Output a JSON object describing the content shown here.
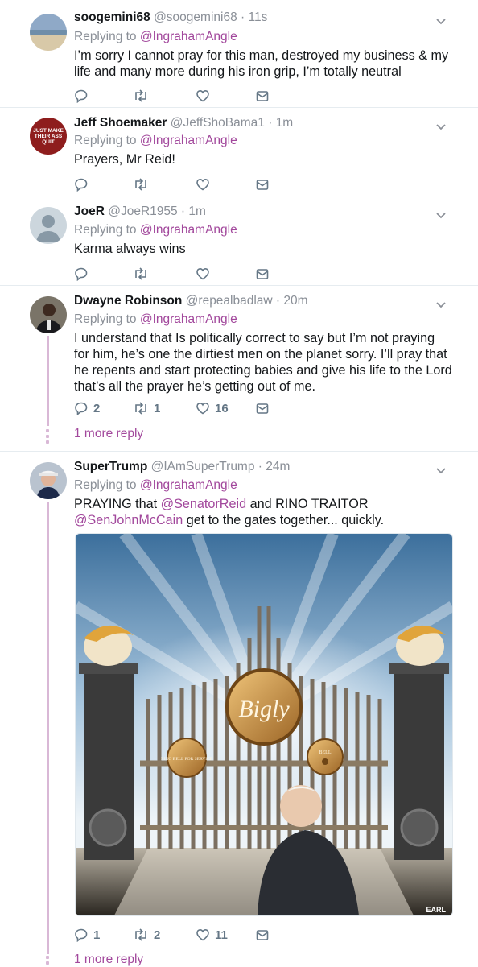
{
  "tweets": [
    {
      "name": "soogemini68",
      "handle": "@soogemini68",
      "sep": " · ",
      "time": "11s",
      "replying_prefix": "Replying to ",
      "replying_to": "@IngrahamAngle",
      "text": "I’m sorry I cannot pray for this man, destroyed my business & my life and many more during his iron grip, I’m totally neutral",
      "counts": {
        "reply": "",
        "retweet": "",
        "like": ""
      }
    },
    {
      "name": "Jeff Shoemaker",
      "handle": "@JeffShoBama1",
      "sep": " · ",
      "time": "1m",
      "replying_prefix": "Replying to ",
      "replying_to": "@IngrahamAngle",
      "text": "Prayers, Mr Reid!",
      "avatar_text": "JUST MAKE THEIR ASS QUIT",
      "counts": {
        "reply": "",
        "retweet": "",
        "like": ""
      }
    },
    {
      "name": "JoeR",
      "handle": "@JoeR1955",
      "sep": " · ",
      "time": "1m",
      "replying_prefix": "Replying to ",
      "replying_to": "@IngrahamAngle",
      "text": "Karma always wins",
      "counts": {
        "reply": "",
        "retweet": "",
        "like": ""
      }
    },
    {
      "name": "Dwayne Robinson",
      "handle": "@repealbadlaw",
      "sep": " · ",
      "time": "20m",
      "replying_prefix": "Replying to ",
      "replying_to": "@IngrahamAngle",
      "text": "I understand that Is politically correct to say but I’m not praying for him, he’s one the dirtiest men on the planet sorry. I’ll pray that he repents and start protecting babies and give his life to the Lord that’s all the prayer he’s getting out of me.",
      "counts": {
        "reply": "2",
        "retweet": "1",
        "like": "16"
      },
      "more_reply": "1 more reply"
    },
    {
      "name": "SuperTrump",
      "handle": "@IAmSuperTrump",
      "sep": " · ",
      "time": "24m",
      "replying_prefix": "Replying to ",
      "replying_to": "@IngrahamAngle",
      "text_parts": [
        "PRAYING that ",
        "@SenatorReid",
        " and RINO TRAITOR ",
        "@SenJohnMcCain",
        " get to the gates together... quickly."
      ],
      "image": {
        "sign_main": "Bigly",
        "sign_left": "RING BELL FOR SERVICE",
        "sign_right": "BELL",
        "signature": "EARL"
      },
      "counts": {
        "reply": "1",
        "retweet": "2",
        "like": "11"
      },
      "more_reply": "1 more reply"
    }
  ],
  "icons": [
    "reply-icon",
    "retweet-icon",
    "like-icon",
    "dm-icon",
    "chevron-down-icon"
  ],
  "colors": {
    "link": "#a2489c",
    "muted": "#8a8f97",
    "thread": "#d9b8d6",
    "icon": "#657786"
  }
}
